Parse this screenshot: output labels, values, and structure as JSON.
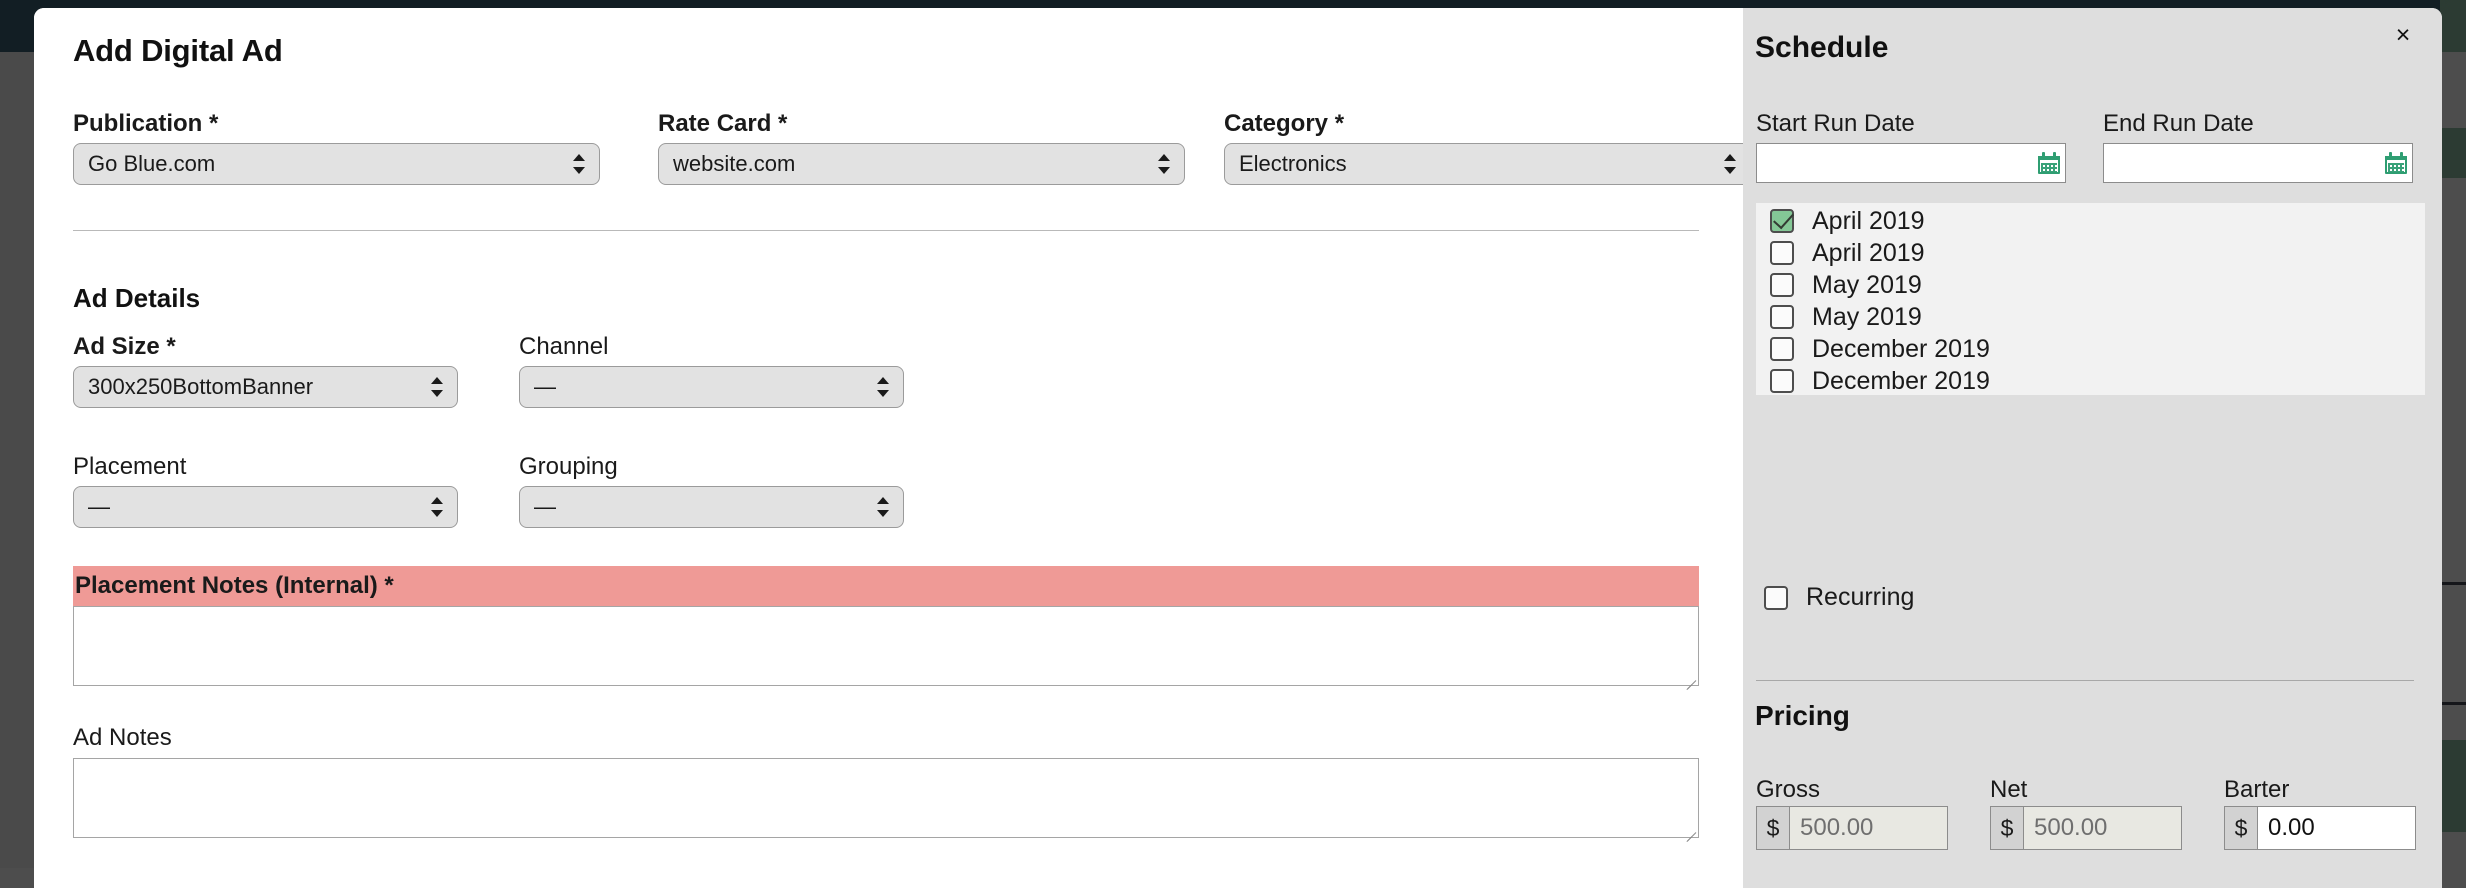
{
  "modal": {
    "title": "Add Digital Ad",
    "close_label": "×"
  },
  "left": {
    "top_fields": [
      {
        "label": "Publication *",
        "value": "Go Blue.com",
        "required": true
      },
      {
        "label": "Rate Card *",
        "value": "website.com",
        "required": true
      },
      {
        "label": "Category *",
        "value": "Electronics",
        "required": true
      }
    ],
    "ad_details_heading": "Ad Details",
    "detail_fields": [
      {
        "label": "Ad Size *",
        "value": "300x250BottomBanner"
      },
      {
        "label": "Channel",
        "value": "—"
      },
      {
        "label": "Placement",
        "value": "—"
      },
      {
        "label": "Grouping",
        "value": "—"
      }
    ],
    "placement_notes": {
      "label": "Placement Notes (Internal) *",
      "value": "",
      "error_color": "#ef9a96"
    },
    "ad_notes": {
      "label": "Ad Notes",
      "value": ""
    }
  },
  "right": {
    "panel_title": "Schedule",
    "start_run_date": {
      "label": "Start Run Date",
      "value": "",
      "icon": "calendar-icon"
    },
    "end_run_date": {
      "label": "End Run Date",
      "value": "",
      "icon": "calendar-icon"
    },
    "months": [
      {
        "label": "April 2019",
        "checked": true
      },
      {
        "label": "April 2019",
        "checked": false
      },
      {
        "label": "May 2019",
        "checked": false
      },
      {
        "label": "May 2019",
        "checked": false
      },
      {
        "label": "December 2019",
        "checked": false
      },
      {
        "label": "December 2019",
        "checked": false
      }
    ],
    "recurring": {
      "label": "Recurring",
      "checked": false
    },
    "pricing_title": "Pricing",
    "pricing": [
      {
        "label": "Gross",
        "currency": "$",
        "value": "500.00",
        "disabled": true
      },
      {
        "label": "Net",
        "currency": "$",
        "value": "500.00",
        "disabled": true
      },
      {
        "label": "Barter",
        "currency": "$",
        "value": "0.00",
        "disabled": false
      }
    ]
  },
  "colors": {
    "accent_green": "#2f9e72",
    "checked_green": "#84c796",
    "error_salmon": "#ef9a96",
    "panel_gray": "#dedede",
    "topbar_navy": "#121e24"
  }
}
